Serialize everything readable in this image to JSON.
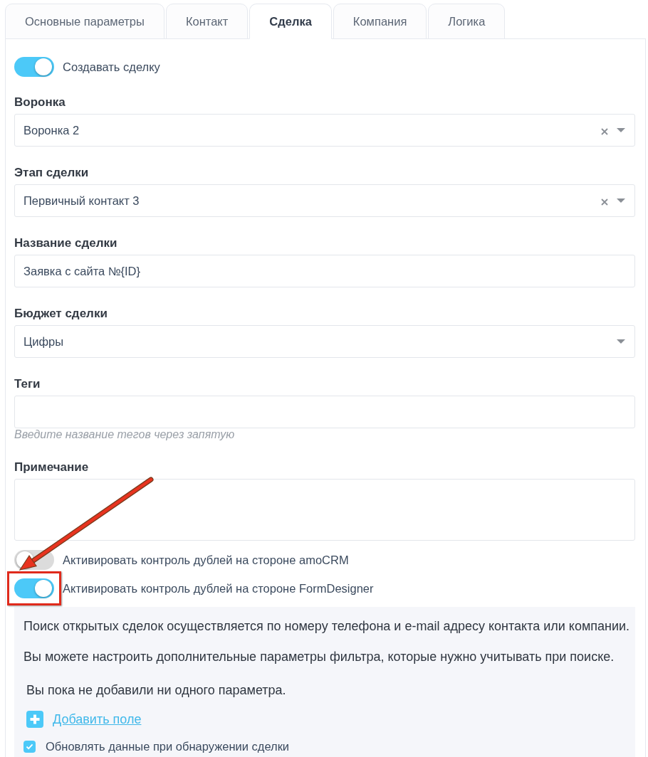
{
  "tabs": [
    {
      "label": "Основные параметры",
      "selected": false
    },
    {
      "label": "Контакт",
      "selected": false
    },
    {
      "label": "Сделка",
      "selected": true
    },
    {
      "label": "Компания",
      "selected": false
    },
    {
      "label": "Логика",
      "selected": false
    }
  ],
  "create_deal": {
    "label": "Создавать сделку",
    "on": true
  },
  "fields": [
    {
      "kind": "select",
      "label": "Воронка",
      "value": "Воронка 2",
      "clearable": true
    },
    {
      "kind": "select",
      "label": "Этап сделки",
      "value": "Первичный контакт 3",
      "clearable": true
    },
    {
      "kind": "text",
      "label": "Название сделки",
      "value": "Заявка с сайта №{ID}"
    },
    {
      "kind": "select",
      "label": "Бюджет сделки",
      "value": "Цифры",
      "clearable": false
    },
    {
      "kind": "text",
      "label": "Теги",
      "hint": "Введите название тегов через запятую"
    },
    {
      "kind": "textarea",
      "label": "Примечание"
    }
  ],
  "duplicate_toggles": [
    {
      "label": "Активировать контроль дублей на стороне amoCRM",
      "on": false,
      "highlighted": false
    },
    {
      "label": "Активировать контроль дублей на стороне FormDesigner",
      "on": true,
      "highlighted": true
    }
  ],
  "duplicate_panel": {
    "paragraphs": [
      "Поиск открытых сделок осуществляется по номеру телефона и e-mail адресу контакта или компании.",
      "Вы можете настроить дополнительные параметры фильтра, которые нужно учитывать при поиске."
    ],
    "empty_note": "Вы пока не добавили ни одного параметра.",
    "add_link": "Добавить поле",
    "update_checkbox": {
      "label": "Обновлять данные при обнаружении сделки",
      "checked": true
    }
  }
}
